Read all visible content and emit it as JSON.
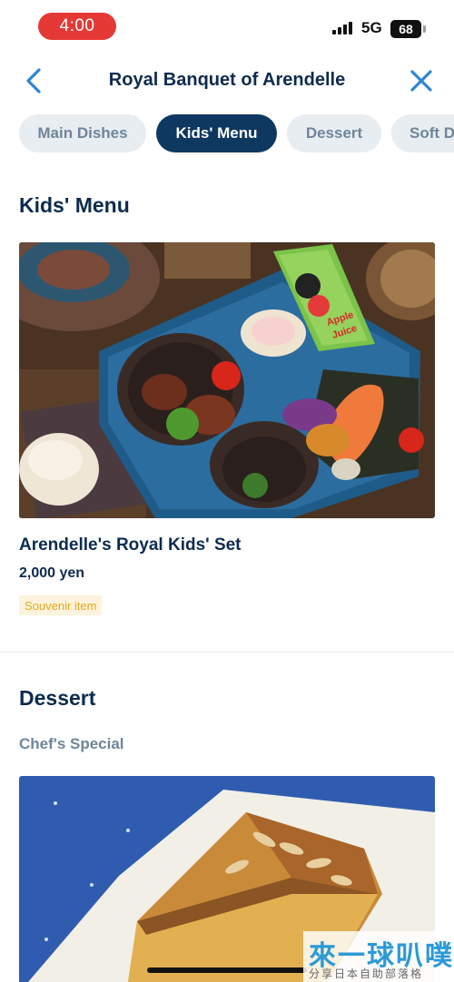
{
  "status_bar": {
    "time": "4:00",
    "network": "5G",
    "battery": "68"
  },
  "header": {
    "title": "Royal Banquet of Arendelle"
  },
  "tabs": [
    {
      "label": "Main Dishes"
    },
    {
      "label": "Kids' Menu"
    },
    {
      "label": "Dessert"
    },
    {
      "label": "Soft D"
    }
  ],
  "kids_menu": {
    "heading": "Kids' Menu",
    "item": {
      "name": "Arendelle's Royal Kids' Set",
      "price": "2,000 yen",
      "badge": "Souvenir item",
      "juice_box_text": [
        "Apple",
        "Juice"
      ]
    }
  },
  "dessert": {
    "heading": "Dessert",
    "subheading": "Chef's Special"
  },
  "watermark": {
    "main": "來一球叭噗",
    "sub": "分享日本自助部落格"
  },
  "colors": {
    "primary": "#0f3860",
    "accent": "#2e86d6",
    "tab_bg": "#e8edf1",
    "badge_text": "#e3a81f",
    "status_red": "#e53935"
  }
}
